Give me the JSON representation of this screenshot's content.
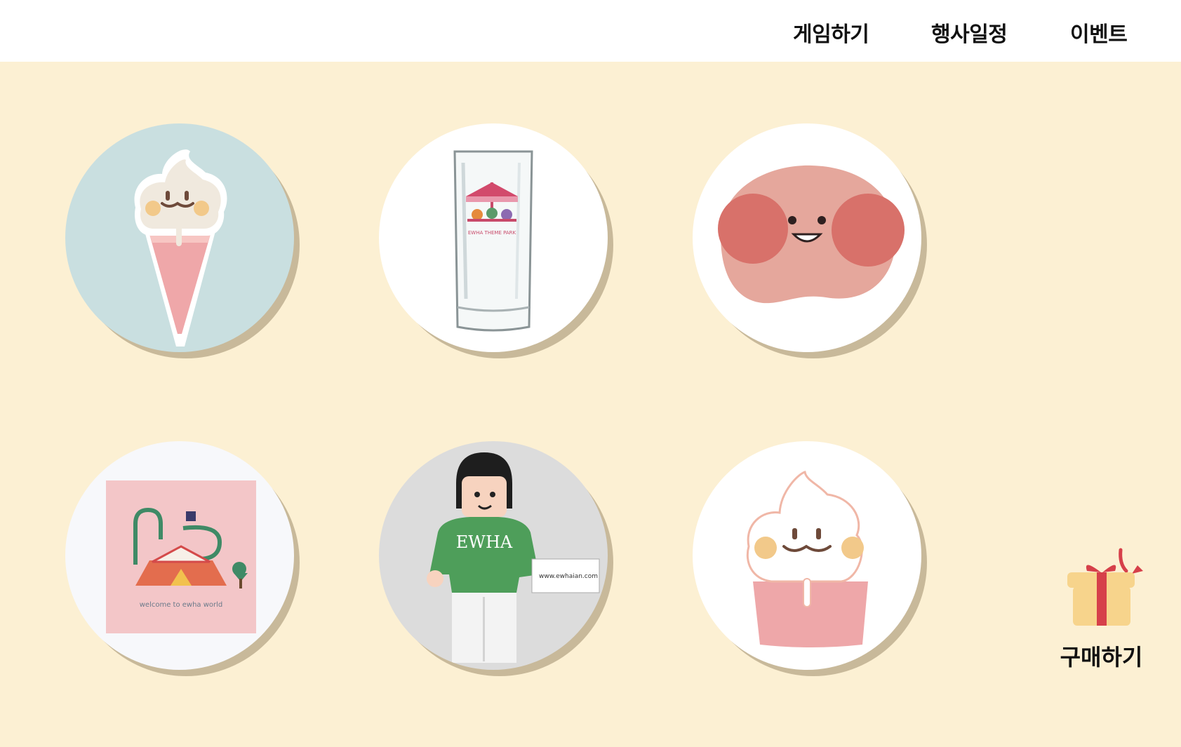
{
  "nav": {
    "items": [
      {
        "label": "게임하기"
      },
      {
        "label": "행사일정"
      },
      {
        "label": "이벤트"
      }
    ]
  },
  "products": [
    {
      "icon": "ice-cream-cone-sticker"
    },
    {
      "icon": "carousel-glass-cup",
      "print": "EWHA THEME PARK"
    },
    {
      "icon": "peach-face-sticker"
    },
    {
      "icon": "ewha-world-cloth",
      "caption": "welcome to ewha world"
    },
    {
      "icon": "ewha-figure",
      "shirt": "EWHA",
      "card": "www.ewhaian.com"
    },
    {
      "icon": "ice-cream-cup-sticker"
    }
  ],
  "buy": {
    "label": "구매하기",
    "icon": "gift-box-icon"
  },
  "colors": {
    "background": "#fcf0d3",
    "header": "#ffffff",
    "accent": "#d6404a"
  }
}
